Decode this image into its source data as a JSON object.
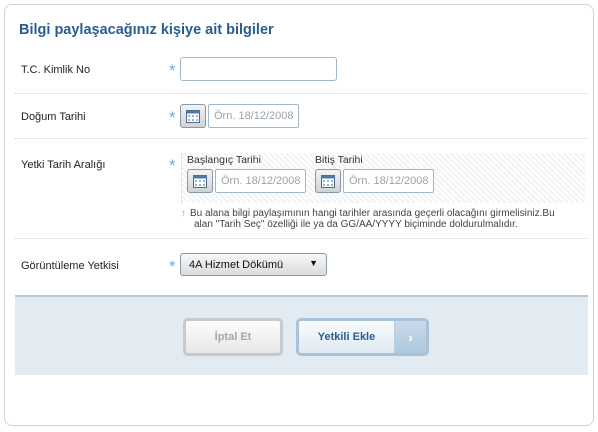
{
  "form": {
    "title": "Bilgi paylaşacağınız kişiye ait bilgiler",
    "required_mark": "*",
    "tc_kimlik": {
      "label": "T.C. Kimlik No",
      "value": ""
    },
    "dogum_tarihi": {
      "label": "Doğum Tarihi",
      "placeholder": "Örn. 18/12/2008"
    },
    "yetki_tarih": {
      "label": "Yetki Tarih Aralığı",
      "start_label": "Başlangıç Tarihi",
      "start_placeholder": "Örn. 18/12/2008",
      "end_label": "Bitiş Tarihi",
      "end_placeholder": "Örn. 18/12/2008",
      "hint_line1": "Bu alana bilgi paylaşımının hangi tarihler arasında geçerli olacağını girmelisiniz.Bu",
      "hint_line2": "alan \"Tarih Seç\" özelliği ile ya da GG/AA/YYYY biçiminde doldurulmalıdır."
    },
    "goruntuleme": {
      "label": "Görüntüleme Yetkisi",
      "selected": "4A Hizmet Dökümü"
    }
  },
  "actions": {
    "cancel_label": "İptal Et",
    "add_label": "Yetkili Ekle"
  },
  "icons": {
    "calendar": "calendar-icon",
    "dropdown": "caret-down-icon",
    "next": "chevron-right-icon",
    "hint": "arrow-up-icon"
  },
  "colors": {
    "title": "#2a5d8f",
    "required": "#7fa7d0",
    "footer_bg": "#e3ebf2"
  }
}
